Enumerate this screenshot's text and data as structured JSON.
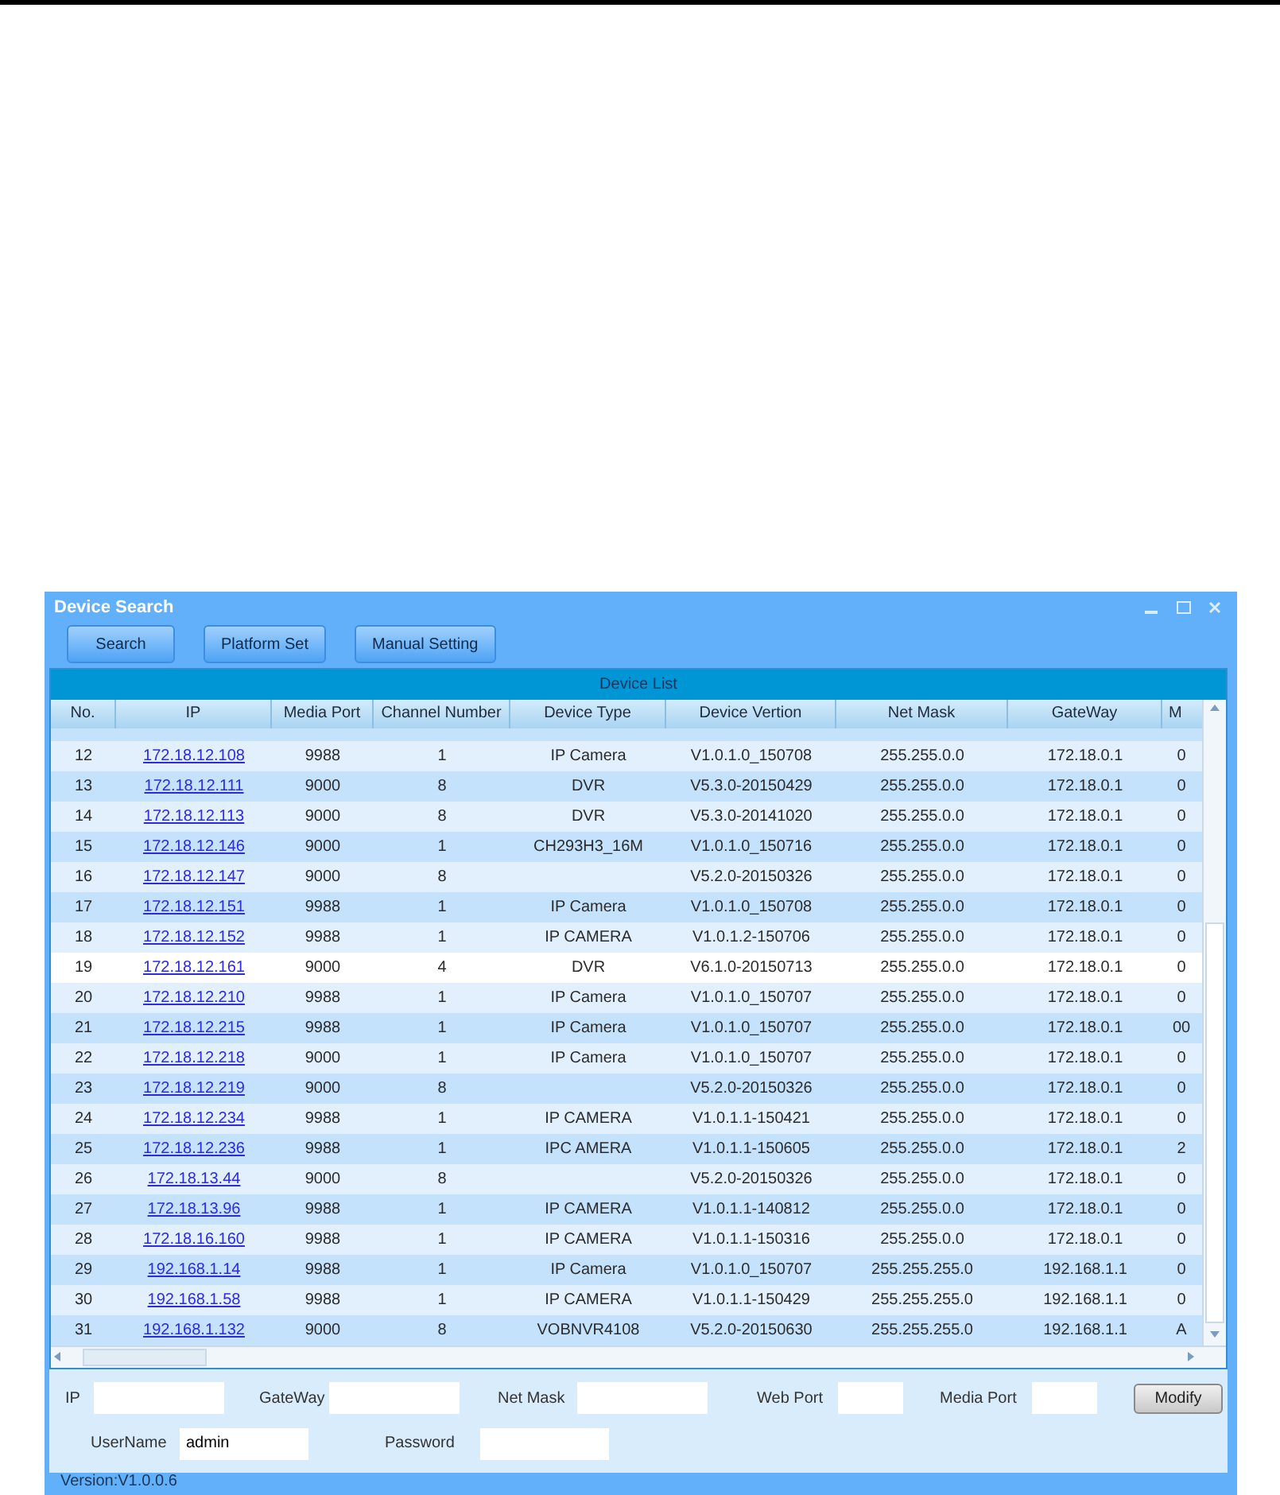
{
  "window": {
    "title": "Device Search"
  },
  "toolbar": [
    "Search",
    "Platform Set",
    "Manual Setting"
  ],
  "table": {
    "title": "Device List",
    "columns": [
      {
        "label": "No.",
        "kind": "text"
      },
      {
        "label": "IP",
        "kind": "link"
      },
      {
        "label": "Media Port",
        "kind": "text"
      },
      {
        "label": "Channel Number",
        "kind": "text"
      },
      {
        "label": "Device Type",
        "kind": "text"
      },
      {
        "label": "Device Vertion",
        "kind": "text"
      },
      {
        "label": "Net Mask",
        "kind": "text"
      },
      {
        "label": "GateWay",
        "kind": "text"
      },
      {
        "label": "M",
        "kind": "text"
      }
    ],
    "rows": [
      {
        "selected": false,
        "cells": [
          "12",
          "172.18.12.108",
          "9988",
          "1",
          "IP Camera",
          "V1.0.1.0_150708",
          "255.255.0.0",
          "172.18.0.1",
          "0"
        ]
      },
      {
        "selected": false,
        "cells": [
          "13",
          "172.18.12.111",
          "9000",
          "8",
          "DVR",
          "V5.3.0-20150429",
          "255.255.0.0",
          "172.18.0.1",
          "0"
        ]
      },
      {
        "selected": false,
        "cells": [
          "14",
          "172.18.12.113",
          "9000",
          "8",
          "DVR",
          "V5.3.0-20141020",
          "255.255.0.0",
          "172.18.0.1",
          "0"
        ]
      },
      {
        "selected": false,
        "cells": [
          "15",
          "172.18.12.146",
          "9000",
          "1",
          "CH293H3_16M",
          "V1.0.1.0_150716",
          "255.255.0.0",
          "172.18.0.1",
          "0"
        ]
      },
      {
        "selected": false,
        "cells": [
          "16",
          "172.18.12.147",
          "9000",
          "8",
          "",
          "V5.2.0-20150326",
          "255.255.0.0",
          "172.18.0.1",
          "0"
        ]
      },
      {
        "selected": false,
        "cells": [
          "17",
          "172.18.12.151",
          "9988",
          "1",
          "IP Camera",
          "V1.0.1.0_150708",
          "255.255.0.0",
          "172.18.0.1",
          "0"
        ]
      },
      {
        "selected": false,
        "cells": [
          "18",
          "172.18.12.152",
          "9988",
          "1",
          "IP CAMERA",
          "V1.0.1.2-150706",
          "255.255.0.0",
          "172.18.0.1",
          "0"
        ]
      },
      {
        "selected": true,
        "cells": [
          "19",
          "172.18.12.161",
          "9000",
          "4",
          "DVR",
          "V6.1.0-20150713",
          "255.255.0.0",
          "172.18.0.1",
          "0"
        ]
      },
      {
        "selected": false,
        "cells": [
          "20",
          "172.18.12.210",
          "9988",
          "1",
          "IP Camera",
          "V1.0.1.0_150707",
          "255.255.0.0",
          "172.18.0.1",
          "0"
        ]
      },
      {
        "selected": false,
        "cells": [
          "21",
          "172.18.12.215",
          "9988",
          "1",
          "IP Camera",
          "V1.0.1.0_150707",
          "255.255.0.0",
          "172.18.0.1",
          "00"
        ]
      },
      {
        "selected": false,
        "cells": [
          "22",
          "172.18.12.218",
          "9000",
          "1",
          "IP Camera",
          "V1.0.1.0_150707",
          "255.255.0.0",
          "172.18.0.1",
          "0"
        ]
      },
      {
        "selected": false,
        "cells": [
          "23",
          "172.18.12.219",
          "9000",
          "8",
          "",
          "V5.2.0-20150326",
          "255.255.0.0",
          "172.18.0.1",
          "0"
        ]
      },
      {
        "selected": false,
        "cells": [
          "24",
          "172.18.12.234",
          "9988",
          "1",
          "IP CAMERA",
          "V1.0.1.1-150421",
          "255.255.0.0",
          "172.18.0.1",
          "0"
        ]
      },
      {
        "selected": false,
        "cells": [
          "25",
          "172.18.12.236",
          "9988",
          "1",
          "IPC AMERA",
          "V1.0.1.1-150605",
          "255.255.0.0",
          "172.18.0.1",
          "2"
        ]
      },
      {
        "selected": false,
        "cells": [
          "26",
          "172.18.13.44",
          "9000",
          "8",
          "",
          "V5.2.0-20150326",
          "255.255.0.0",
          "172.18.0.1",
          "0"
        ]
      },
      {
        "selected": false,
        "cells": [
          "27",
          "172.18.13.96",
          "9988",
          "1",
          "IP CAMERA",
          "V1.0.1.1-140812",
          "255.255.0.0",
          "172.18.0.1",
          "0"
        ]
      },
      {
        "selected": false,
        "cells": [
          "28",
          "172.18.16.160",
          "9988",
          "1",
          "IP CAMERA",
          "V1.0.1.1-150316",
          "255.255.0.0",
          "172.18.0.1",
          "0"
        ]
      },
      {
        "selected": false,
        "cells": [
          "29",
          "192.168.1.14",
          "9988",
          "1",
          "IP Camera",
          "V1.0.1.0_150707",
          "255.255.255.0",
          "192.168.1.1",
          "0"
        ]
      },
      {
        "selected": false,
        "cells": [
          "30",
          "192.168.1.58",
          "9988",
          "1",
          "IP CAMERA",
          "V1.0.1.1-150429",
          "255.255.255.0",
          "192.168.1.1",
          "0"
        ]
      },
      {
        "selected": false,
        "cells": [
          "31",
          "192.168.1.132",
          "9000",
          "8",
          "VOBNVR4108",
          "V5.2.0-20150630",
          "255.255.255.0",
          "192.168.1.1",
          "A"
        ]
      }
    ]
  },
  "form": {
    "rows": [
      {
        "fields": [
          {
            "label": "IP"
          },
          {
            "label": "GateWay"
          },
          {
            "label": "Net Mask"
          },
          {
            "label": "Web Port"
          },
          {
            "label": "Media Port"
          }
        ]
      },
      {
        "fields": [
          {
            "label": "UserName",
            "value": "admin"
          },
          {
            "label": "Password"
          }
        ]
      }
    ],
    "button": "Modify"
  },
  "status_bar": "Version:V1.0.0.6"
}
